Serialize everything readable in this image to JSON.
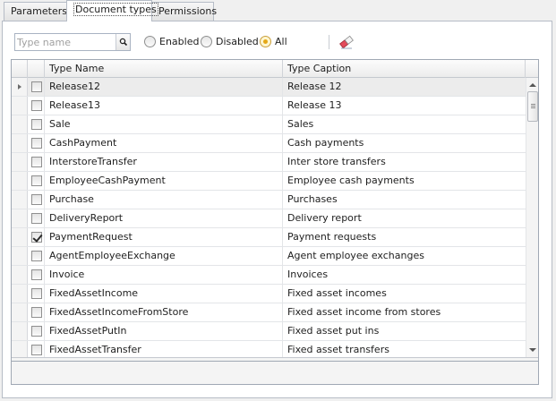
{
  "tabs": [
    {
      "label": "Parameters",
      "active": false
    },
    {
      "label": "Document types",
      "active": true
    },
    {
      "label": "Permissions",
      "active": false
    }
  ],
  "filter": {
    "search_placeholder": "Type name",
    "search_value": "",
    "search_icon": "search-icon",
    "options": [
      {
        "label": "Enabled",
        "selected": false
      },
      {
        "label": "Disabled",
        "selected": false
      },
      {
        "label": "All",
        "selected": true
      }
    ],
    "clear_icon": "eraser-icon"
  },
  "grid": {
    "columns": [
      "Type Name",
      "Type Caption"
    ],
    "rows": [
      {
        "name": "Release12",
        "caption": "Release 12",
        "checked": false,
        "focused": true
      },
      {
        "name": "Release13",
        "caption": "Release 13",
        "checked": false
      },
      {
        "name": "Sale",
        "caption": "Sales",
        "checked": false
      },
      {
        "name": "CashPayment",
        "caption": "Cash payments",
        "checked": false
      },
      {
        "name": "InterstoreTransfer",
        "caption": "Inter store transfers",
        "checked": false
      },
      {
        "name": "EmployeeCashPayment",
        "caption": "Employee cash payments",
        "checked": false
      },
      {
        "name": "Purchase",
        "caption": "Purchases",
        "checked": false
      },
      {
        "name": "DeliveryReport",
        "caption": "Delivery report",
        "checked": false
      },
      {
        "name": "PaymentRequest",
        "caption": "Payment requests",
        "checked": true
      },
      {
        "name": "AgentEmployeeExchange",
        "caption": "Agent employee exchanges",
        "checked": false
      },
      {
        "name": "Invoice",
        "caption": "Invoices",
        "checked": false
      },
      {
        "name": "FixedAssetIncome",
        "caption": "Fixed asset incomes",
        "checked": false
      },
      {
        "name": "FixedAssetIncomeFromStore",
        "caption": "Fixed asset income from stores",
        "checked": false
      },
      {
        "name": "FixedAssetPutIn",
        "caption": "Fixed asset put ins",
        "checked": false
      },
      {
        "name": "FixedAssetTransfer",
        "caption": "Fixed asset transfers",
        "checked": false
      }
    ]
  },
  "colors": {
    "accent": "#e5a817",
    "border": "#a0a8b4"
  }
}
